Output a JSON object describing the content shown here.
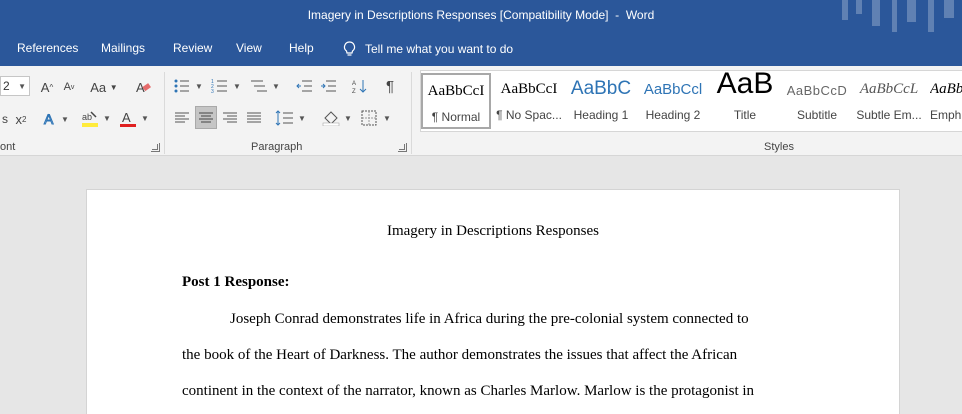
{
  "window": {
    "title": "Imagery in Descriptions Responses [Compatibility Mode]  -  Word"
  },
  "menu": {
    "tabs": [
      "References",
      "Mailings",
      "Review",
      "View",
      "Help"
    ],
    "tell_me": "Tell me what you want to do"
  },
  "ribbon": {
    "font": {
      "size_value": "2",
      "change_case_label": "Aa",
      "group_label": "ont"
    },
    "paragraph": {
      "group_label": "Paragraph"
    },
    "styles": {
      "group_label": "Styles",
      "items": [
        {
          "sample": "AaBbCcI",
          "name": "¶ Normal"
        },
        {
          "sample": "AaBbCcI",
          "name": "¶ No Spac..."
        },
        {
          "sample": "AaBbC",
          "name": "Heading 1"
        },
        {
          "sample": "AaBbCcl",
          "name": "Heading 2"
        },
        {
          "sample": "AaB",
          "name": "Title"
        },
        {
          "sample": "AaBbCcD",
          "name": "Subtitle"
        },
        {
          "sample": "AaBbCcL",
          "name": "Subtle Em..."
        },
        {
          "sample": "AaBbCcL",
          "name": "Emph"
        }
      ]
    }
  },
  "document": {
    "title": "Imagery in Descriptions Responses",
    "heading": "Post 1 Response:",
    "lines": [
      "Joseph Conrad demonstrates life in Africa during the pre-colonial system connected to",
      "the book of the Heart of Darkness. The author demonstrates the issues that affect the African",
      "continent in the context of the narrator, known as Charles Marlow. Marlow is the protagonist in"
    ]
  },
  "colors": {
    "titlebar": "#2b579a",
    "ribbon": "#f3f3f3",
    "canvas": "#e6e6e6",
    "heading1": "#2e74b5"
  }
}
